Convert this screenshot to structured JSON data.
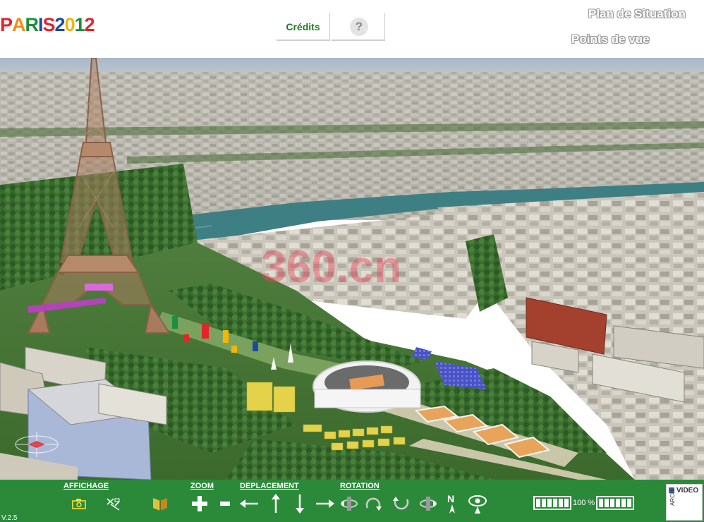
{
  "header": {
    "logo_text": "PARIS2012",
    "logo_letters": [
      {
        "ch": "P",
        "color": "#e3242b"
      },
      {
        "ch": "A",
        "color": "#f28c1c"
      },
      {
        "ch": "R",
        "color": "#1e8e3e"
      },
      {
        "ch": "I",
        "color": "#1a4ba3"
      },
      {
        "ch": "S",
        "color": "#e3242b"
      },
      {
        "ch": "2",
        "color": "#1a4ba3"
      },
      {
        "ch": "0",
        "color": "#f2b705"
      },
      {
        "ch": "1",
        "color": "#1e8e3e"
      },
      {
        "ch": "2",
        "color": "#e3242b"
      }
    ],
    "credits_tab": "Crédits",
    "help_tab": "?",
    "plan_link": "Plan de Situation",
    "points_link": "Points de vue"
  },
  "view": {
    "watermark": "360.cn"
  },
  "toolbar": {
    "affichage_label": "AFFICHAGE",
    "zoom_label": "ZOOM",
    "deplacement_label": "DEPLACEMENT",
    "rotation_label": "ROTATION",
    "north_label": "N",
    "zoom_level": "100 %",
    "version": "V.2.5",
    "video_label": "VIDEO",
    "archi_label": "ARCHI"
  },
  "colors": {
    "toolbar_green": "#2b8a3a",
    "credits_green": "#1e7a2a",
    "sky": "#b7c3d0",
    "river": "#3e7f84",
    "trees": "#2e6a2a",
    "buildings": "#c9c6bd"
  }
}
